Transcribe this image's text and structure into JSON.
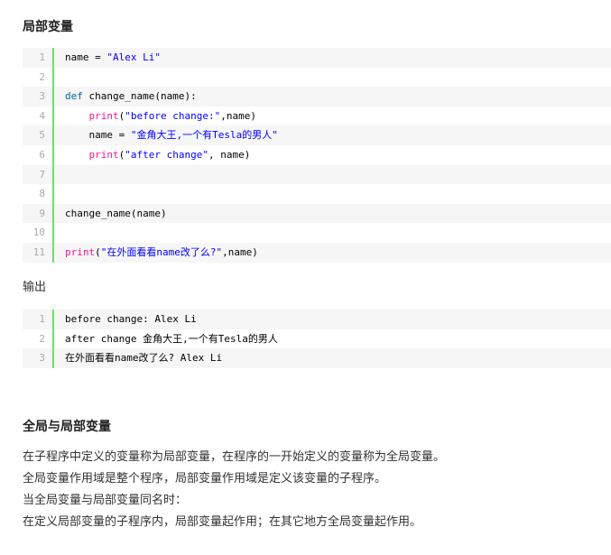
{
  "heading_local": "局部变量",
  "code1": [
    {
      "num": "1",
      "parts": [
        {
          "t": "name = ",
          "c": ""
        },
        {
          "t": "\"Alex Li\"",
          "c": "str"
        }
      ]
    },
    {
      "num": "2",
      "parts": []
    },
    {
      "num": "3",
      "parts": [
        {
          "t": "def",
          "c": "kw"
        },
        {
          "t": " change_name(name):",
          "c": ""
        }
      ]
    },
    {
      "num": "4",
      "parts": [
        {
          "t": "    ",
          "c": ""
        },
        {
          "t": "print",
          "c": "fn"
        },
        {
          "t": "(",
          "c": ""
        },
        {
          "t": "\"before change:\"",
          "c": "str"
        },
        {
          "t": ",name)",
          "c": ""
        }
      ]
    },
    {
      "num": "5",
      "parts": [
        {
          "t": "    name = ",
          "c": ""
        },
        {
          "t": "\"金角大王,一个有Tesla的男人\"",
          "c": "str"
        }
      ]
    },
    {
      "num": "6",
      "parts": [
        {
          "t": "    ",
          "c": ""
        },
        {
          "t": "print",
          "c": "fn"
        },
        {
          "t": "(",
          "c": ""
        },
        {
          "t": "\"after change\"",
          "c": "str"
        },
        {
          "t": ", name)",
          "c": ""
        }
      ]
    },
    {
      "num": "7",
      "parts": []
    },
    {
      "num": "8",
      "parts": []
    },
    {
      "num": "9",
      "parts": [
        {
          "t": "change_name(name)",
          "c": ""
        }
      ]
    },
    {
      "num": "10",
      "parts": []
    },
    {
      "num": "11",
      "parts": [
        {
          "t": "print",
          "c": "fn"
        },
        {
          "t": "(",
          "c": ""
        },
        {
          "t": "\"在外面看看name改了么?\"",
          "c": "str"
        },
        {
          "t": ",name)",
          "c": ""
        }
      ]
    }
  ],
  "output_label": "输出",
  "code2": [
    {
      "num": "1",
      "parts": [
        {
          "t": "before change: Alex Li",
          "c": ""
        }
      ]
    },
    {
      "num": "2",
      "parts": [
        {
          "t": "after change 金角大王,一个有Tesla的男人",
          "c": ""
        }
      ]
    },
    {
      "num": "3",
      "parts": [
        {
          "t": "在外面看看name改了么? Alex Li",
          "c": ""
        }
      ]
    }
  ],
  "heading_global": "全局与局部变量",
  "paragraphs": [
    "在子程序中定义的变量称为局部变量，在程序的一开始定义的变量称为全局变量。",
    "全局变量作用域是整个程序，局部变量作用域是定义该变量的子程序。",
    "当全局变量与局部变量同名时：",
    "在定义局部变量的子程序内，局部变量起作用；在其它地方全局变量起作用。"
  ]
}
